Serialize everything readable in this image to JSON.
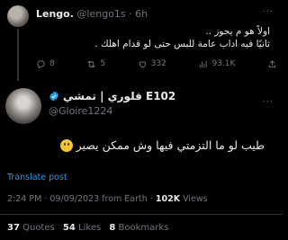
{
  "reply_tweet": {
    "name": "Lengo.",
    "handle": "@lengo1s",
    "separator": "·",
    "age": "6h",
    "more": "···",
    "text_line1": "اولاً هو م يجوز ..",
    "text_line2": "ثانيًا فيه اداب عامة للبس حتى لو قدام اهلك .",
    "replies": "8",
    "retweets": "5",
    "likes": "332",
    "views": "93.1K"
  },
  "main_tweet": {
    "name": "قلوري | تمشي E102",
    "verified": "verified-badge-icon",
    "handle": "@Gloire1224",
    "more": "···",
    "text": "طيب لو ما التزمتي فيها وش ممكن يصير",
    "emoji": "thinking-face-icon",
    "translate_label": "Translate post",
    "time": "2:24 PM",
    "date": "09/09/2023",
    "source": "from Earth",
    "views_count": "102K",
    "views_label": "Views",
    "dot": "·",
    "quotes_count": "37",
    "quotes_label": "Quotes",
    "likes_count": "54",
    "likes_label": "Likes",
    "bookmarks_count": "8",
    "bookmarks_label": "Bookmarks"
  },
  "colors": {
    "background": "#000000",
    "text": "#e7e9ea",
    "muted": "#71767b",
    "link": "#1d9bf0",
    "verified": "#1d9bf0"
  }
}
